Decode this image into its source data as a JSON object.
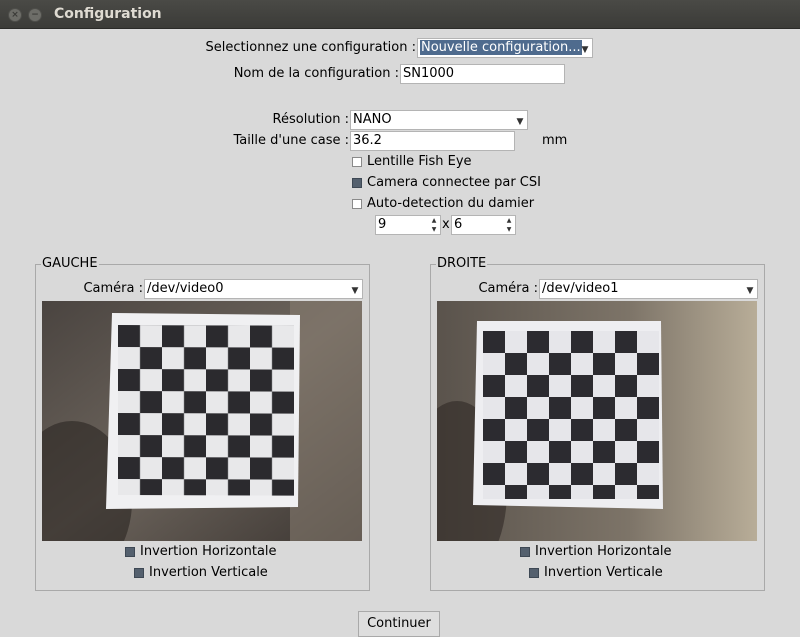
{
  "window": {
    "title": "Configuration",
    "close_glyph": "×",
    "minimize_glyph": "−"
  },
  "config": {
    "select_label": "Selectionnez une configuration :",
    "select_value": "Nouvelle configuration...",
    "name_label": "Nom de la configuration :",
    "name_value": "SN1000"
  },
  "settings": {
    "resolution_label": "Résolution :",
    "resolution_value": "NANO",
    "square_size_label": "Taille d'une case :",
    "square_size_value": "36.2",
    "square_size_unit": "mm",
    "fisheye_label": "Lentille Fish Eye",
    "fisheye_checked": false,
    "csi_label": "Camera connectee par CSI",
    "csi_checked": true,
    "autodetect_label": "Auto-detection du damier",
    "autodetect_checked": false,
    "grid_cols": "9",
    "grid_sep": "x",
    "grid_rows": "6"
  },
  "left": {
    "group_title": "GAUCHE",
    "camera_label": "Caméra :",
    "camera_value": "/dev/video0",
    "flip_h_label": "Invertion Horizontale",
    "flip_h_checked": true,
    "flip_v_label": "Invertion Verticale",
    "flip_v_checked": true
  },
  "right": {
    "group_title": "DROITE",
    "camera_label": "Caméra :",
    "camera_value": "/dev/video1",
    "flip_h_label": "Invertion Horizontale",
    "flip_h_checked": true,
    "flip_v_label": "Invertion Verticale",
    "flip_v_checked": true
  },
  "actions": {
    "continue_label": "Continuer"
  },
  "colors": {
    "window_bg": "#d9d9d9",
    "titlebar": "#3b3b38",
    "selection": "#4f6b8e",
    "checkbox_checked": "#54606e"
  },
  "icons": {
    "dropdown": "chevron-down-icon",
    "spinner": "spinner-arrows-icon"
  }
}
